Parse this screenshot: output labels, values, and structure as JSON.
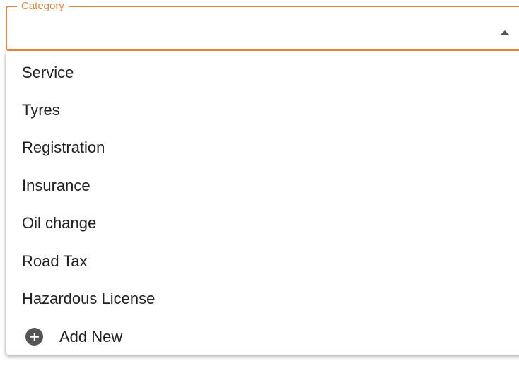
{
  "field": {
    "label": "Category",
    "value": ""
  },
  "menu": {
    "items": [
      "Service",
      "Tyres",
      "Registration",
      "Insurance",
      "Oil change",
      "Road Tax",
      "Hazardous License"
    ],
    "add_new_label": "Add New",
    "add_new_icon": "plus-circle-icon"
  },
  "colors": {
    "accent": "#e8833a",
    "text": "#212121",
    "icon": "#555555"
  }
}
